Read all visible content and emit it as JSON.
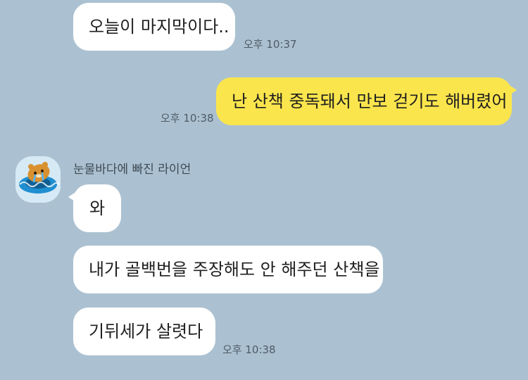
{
  "messages": [
    {
      "id": "m1",
      "text": "오늘이 마지막이다..",
      "direction": "incoming",
      "time": "오후 10:37"
    },
    {
      "id": "m2",
      "text": "난 산책 중독돼서 만보 걷기도 해버렸어",
      "direction": "outgoing",
      "time": "오후 10:38"
    },
    {
      "id": "m3",
      "text": "와",
      "direction": "incoming"
    },
    {
      "id": "m4",
      "text": "내가 골백번을 주장해도 안 해주던 산책을",
      "direction": "incoming"
    },
    {
      "id": "m5",
      "text": "기뒤세가 살렷다",
      "direction": "incoming",
      "time": "오후 10:38"
    }
  ],
  "sender": {
    "name": "눈물바다에 빠진 라이언",
    "avatar_icon": "ryan-crying-in-tube-icon"
  },
  "colors": {
    "background": "#abc1d1",
    "incoming_bubble": "#ffffff",
    "outgoing_bubble": "#fbe54d"
  }
}
